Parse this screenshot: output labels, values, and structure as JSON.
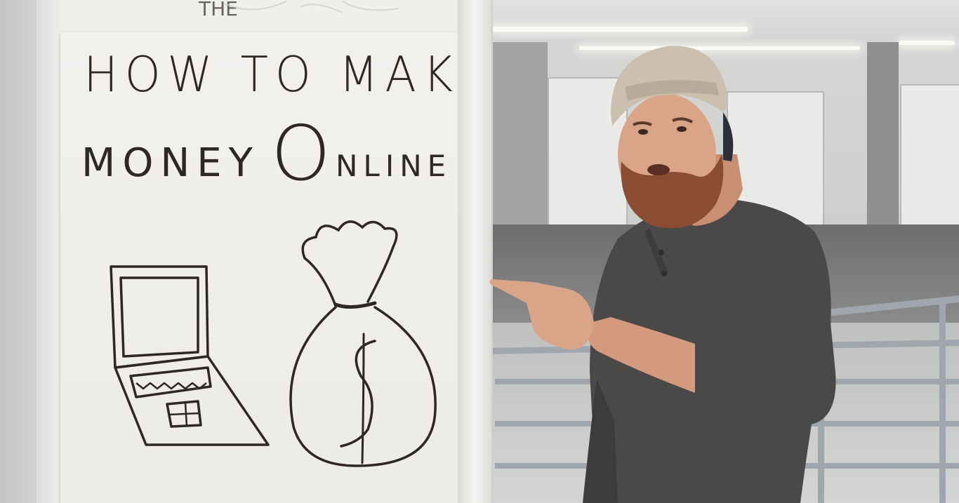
{
  "chart_handwriting": {
    "line1": "HOW TO MAKE",
    "line2_word1": "MONEY",
    "line2_word2_initial": "O",
    "line2_word2_rest": "NLINE",
    "money_symbol": "$",
    "top_page_scribble": "THE"
  },
  "colors": {
    "marker": "#2e2724",
    "paper": "#efeeea",
    "shirt": "#4b4848",
    "cap": "#cbbfae",
    "beard": "#8a4d33",
    "skin": "#d9a487",
    "railing": "#9fa6ad"
  },
  "drawings": [
    "laptop-drawing",
    "money-bag-drawing"
  ]
}
